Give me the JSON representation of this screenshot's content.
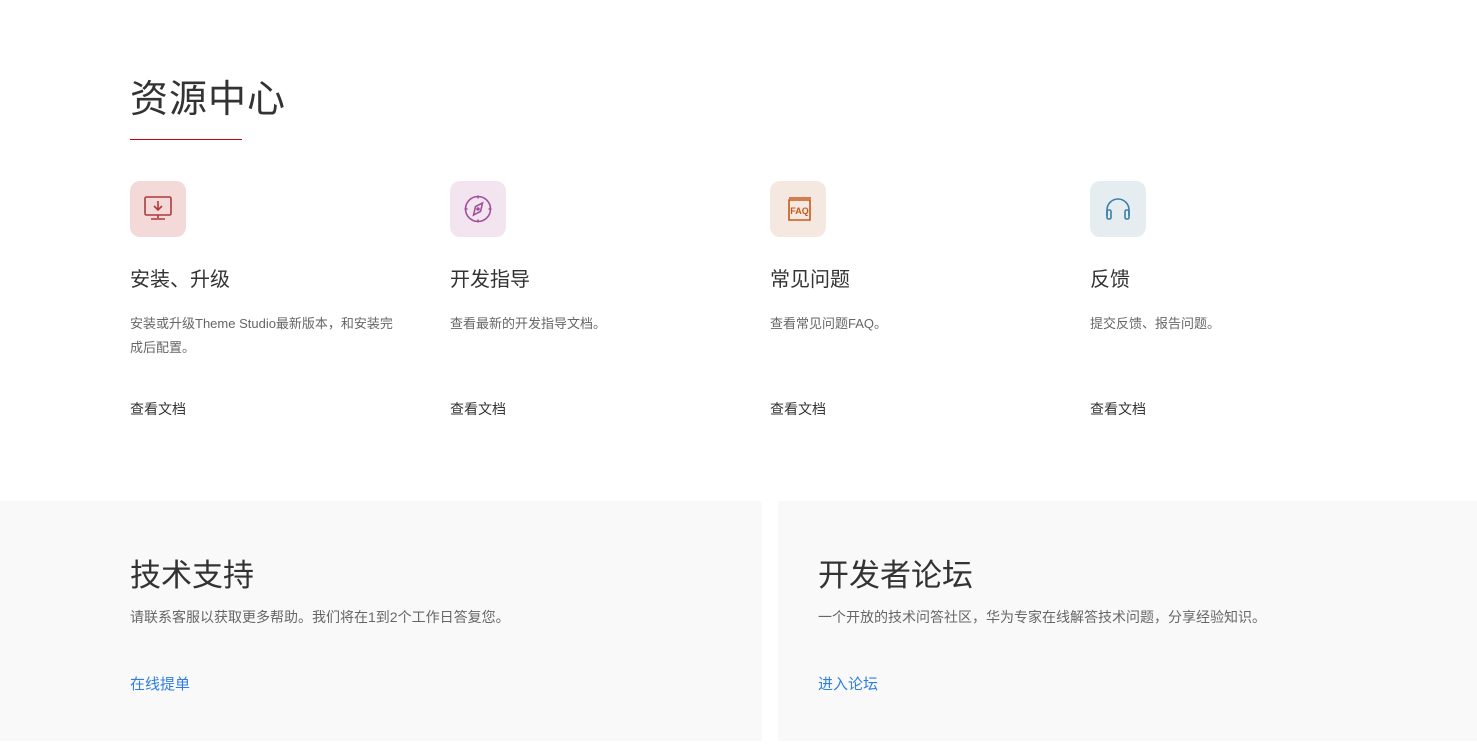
{
  "title": "资源中心",
  "cards": [
    {
      "title": "安装、升级",
      "desc": "安装或升级Theme Studio最新版本，和安装完成后配置。",
      "link": "查看文档",
      "icon": "monitor-download-icon",
      "color": "#b0393a",
      "bg": "#f4d9d9"
    },
    {
      "title": "开发指导",
      "desc": "查看最新的开发指导文档。",
      "link": "查看文档",
      "icon": "compass-icon",
      "color": "#a0509a",
      "bg": "#f3e5f0"
    },
    {
      "title": "常见问题",
      "desc": "查看常见问题FAQ。",
      "link": "查看文档",
      "icon": "faq-book-icon",
      "color": "#c8581a",
      "bg": "#f4e8e0"
    },
    {
      "title": "反馈",
      "desc": "提交反馈、报告问题。",
      "link": "查看文档",
      "icon": "headphones-icon",
      "color": "#3b7ea6",
      "bg": "#e6edf1"
    }
  ],
  "support": {
    "title": "技术支持",
    "desc": "请联系客服以获取更多帮助。我们将在1到2个工作日答复您。",
    "link": "在线提单"
  },
  "forum": {
    "title": "开发者论坛",
    "desc": "一个开放的技术问答社区，华为专家在线解答技术问题，分享经验知识。",
    "link": "进入论坛"
  }
}
